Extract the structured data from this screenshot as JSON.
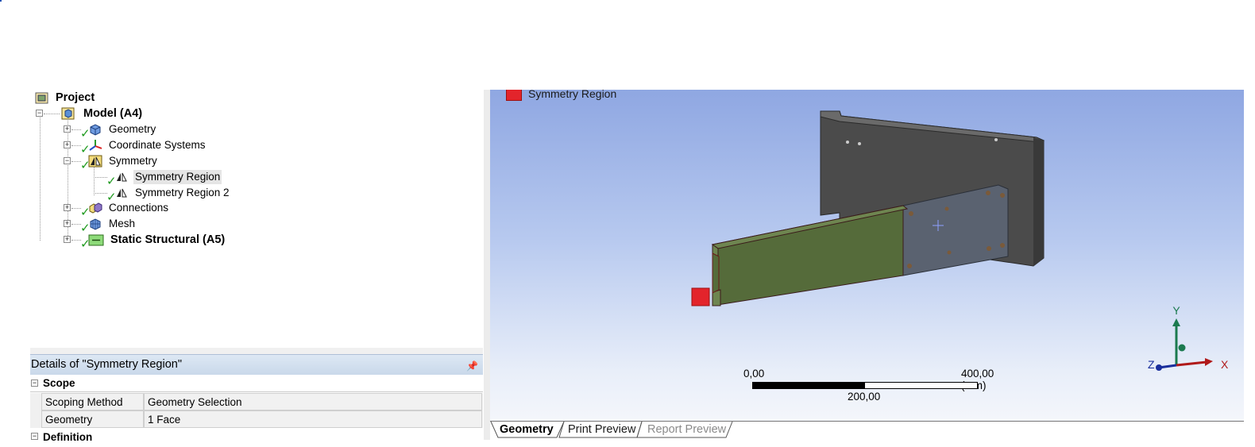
{
  "tree": {
    "root": "Project",
    "model": "Model (A4)",
    "items": [
      {
        "label": "Geometry"
      },
      {
        "label": "Coordinate Systems"
      },
      {
        "label": "Symmetry"
      },
      {
        "label": "Symmetry Region"
      },
      {
        "label": "Symmetry Region 2"
      },
      {
        "label": "Connections"
      },
      {
        "label": "Mesh"
      },
      {
        "label": "Static Structural (A5)"
      }
    ]
  },
  "details": {
    "title": "Details of \"Symmetry Region\"",
    "pin_icon": "pin-icon",
    "sections": [
      {
        "label": "Scope",
        "rows": [
          {
            "key": "Scoping Method",
            "value": "Geometry Selection"
          },
          {
            "key": "Geometry",
            "value": "1 Face"
          }
        ]
      },
      {
        "label": "Definition"
      }
    ]
  },
  "viewport": {
    "legend_label": "Symmetry Region",
    "legend_color": "#e3242b",
    "scale": {
      "left": "0,00",
      "right": "400,00 (mm)",
      "middle": "200,00"
    },
    "axes": {
      "y": "Y",
      "x": "X",
      "z": "Z"
    }
  },
  "tabs": [
    {
      "label": "Geometry"
    },
    {
      "label": "Print Preview"
    },
    {
      "label": "Report Preview"
    }
  ],
  "colors": {
    "accent": "#c9d8ea",
    "body_green": "#556b3a",
    "plate_gray": "#4a4a4a",
    "check_green": "#1e9a1e"
  }
}
